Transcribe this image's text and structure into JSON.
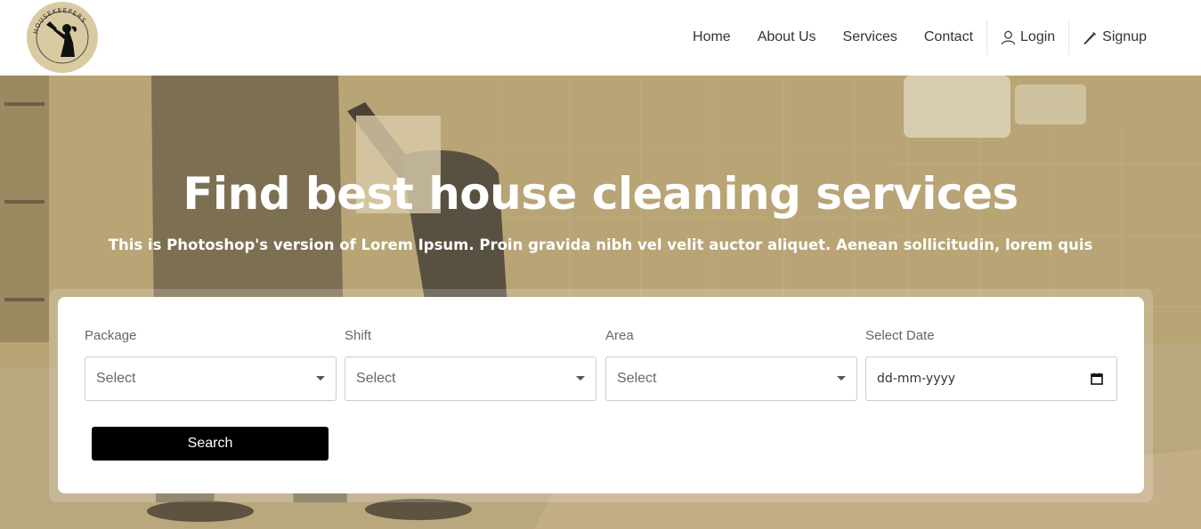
{
  "brand": {
    "logo_text": "HOUSEKEEPERS",
    "logo_color": "#d9cba1"
  },
  "nav": {
    "items": [
      {
        "label": "Home"
      },
      {
        "label": "About Us"
      },
      {
        "label": "Services"
      },
      {
        "label": "Contact"
      }
    ],
    "login_label": "Login",
    "signup_label": "Signup",
    "login_icon": "user-icon",
    "signup_icon": "pencil-icon"
  },
  "hero": {
    "title": "Find best house cleaning services",
    "subtitle": "This is Photoshop's version of Lorem Ipsum. Proin gravida nibh vel velit auctor aliquet. Aenean sollicitudin, lorem quis",
    "overlay_color": "#b6a172"
  },
  "search": {
    "fields": [
      {
        "label": "Package",
        "value": "Select"
      },
      {
        "label": "Shift",
        "value": "Select"
      },
      {
        "label": "Area",
        "value": "Select"
      },
      {
        "label": "Select Date",
        "value": "dd-mm-yyyy"
      }
    ],
    "button_label": "Search",
    "button_color": "#000000"
  }
}
